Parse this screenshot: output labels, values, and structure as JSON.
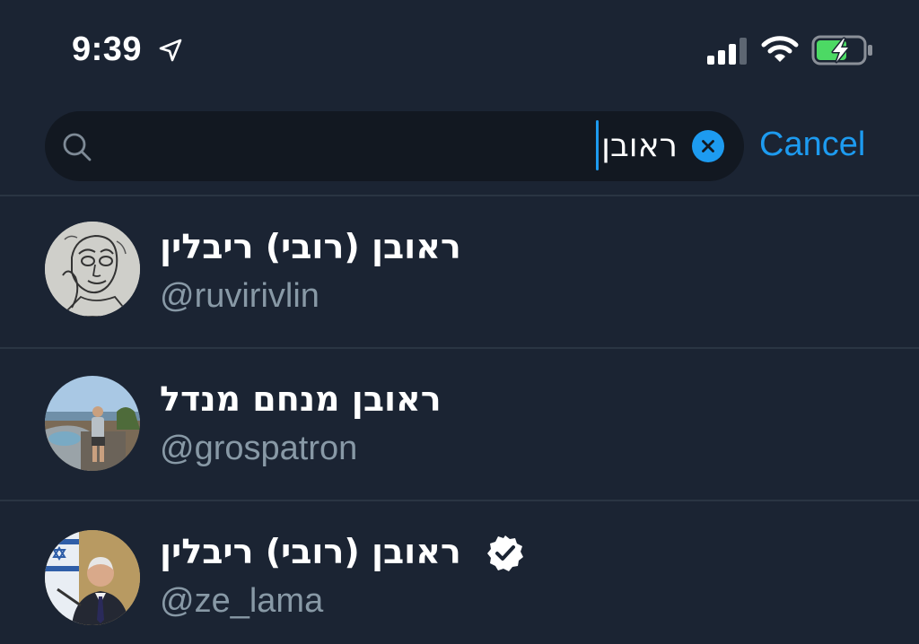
{
  "status_bar": {
    "time": "9:39",
    "icons": [
      "location-arrow-icon",
      "cellular-signal-icon",
      "wifi-icon",
      "battery-charging-icon"
    ]
  },
  "search": {
    "query": "ראובן",
    "icon": "search-icon",
    "clear_icon": "clear-icon",
    "cancel_label": "Cancel"
  },
  "colors": {
    "background": "#1b2433",
    "search_field": "#121821",
    "accent": "#1d9bf0",
    "secondary_text": "#8899a6",
    "divider": "#2a3543"
  },
  "results": [
    {
      "name": "ראובן (רובי) ריבלין",
      "handle": "@ruvirivlin",
      "verified": false,
      "avatar": "sketch-portrait-avatar"
    },
    {
      "name": "ראובן מנחם מנדל",
      "handle": "@grospatron",
      "verified": false,
      "avatar": "landscape-photo-avatar"
    },
    {
      "name": "ראובן (רובי) ריבלין",
      "handle": "@ze_lama",
      "verified": true,
      "avatar": "official-portrait-avatar"
    }
  ]
}
